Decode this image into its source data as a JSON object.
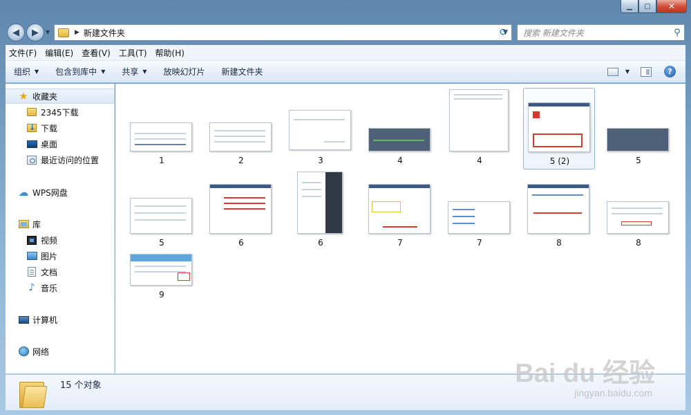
{
  "window": {
    "caption_min": "▁",
    "caption_max": "▢",
    "caption_close": "✕"
  },
  "address": {
    "folder_icon": "folder-icon",
    "path_sep": "▶",
    "path": "新建文件夹",
    "search_placeholder": "搜索 新建文件夹"
  },
  "menu": [
    "文件(F)",
    "编辑(E)",
    "查看(V)",
    "工具(T)",
    "帮助(H)"
  ],
  "toolbar": {
    "organize": "组织",
    "include_in_library": "包含到库中",
    "share": "共享",
    "slideshow": "放映幻灯片",
    "new_folder": "新建文件夹"
  },
  "nav": {
    "favorites": "收藏夹",
    "fav_items": [
      "2345下载",
      "下载",
      "桌面",
      "最近访问的位置"
    ],
    "wps": "WPS网盘",
    "libraries": "库",
    "lib_items": [
      "视频",
      "图片",
      "文档",
      "音乐"
    ],
    "computer": "计算机",
    "network": "网络"
  },
  "files": [
    {
      "label": "1"
    },
    {
      "label": "2"
    },
    {
      "label": "3"
    },
    {
      "label": "4"
    },
    {
      "label": "4"
    },
    {
      "label": "5 (2)"
    },
    {
      "label": "5"
    },
    {
      "label": "5"
    },
    {
      "label": "6"
    },
    {
      "label": "6"
    },
    {
      "label": "7"
    },
    {
      "label": "7"
    },
    {
      "label": "8"
    },
    {
      "label": "8"
    },
    {
      "label": "9"
    }
  ],
  "status": {
    "count": "15 个对象"
  },
  "watermark": {
    "brand": "Bai du 经验",
    "url": "jingyan.baidu.com"
  }
}
